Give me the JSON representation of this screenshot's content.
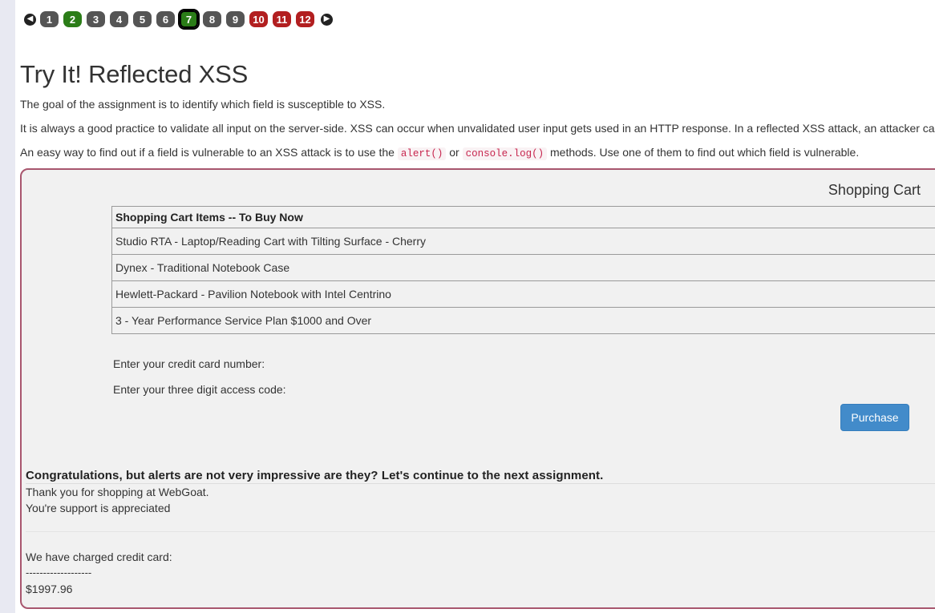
{
  "pager": {
    "prev_icon": "arrow-left-circle-icon",
    "next_icon": "arrow-right-circle-icon",
    "pages": [
      {
        "label": "1",
        "status": "grey"
      },
      {
        "label": "2",
        "status": "green"
      },
      {
        "label": "3",
        "status": "grey"
      },
      {
        "label": "4",
        "status": "grey"
      },
      {
        "label": "5",
        "status": "grey"
      },
      {
        "label": "6",
        "status": "grey"
      },
      {
        "label": "7",
        "status": "current"
      },
      {
        "label": "8",
        "status": "grey"
      },
      {
        "label": "9",
        "status": "grey"
      },
      {
        "label": "10",
        "status": "red"
      },
      {
        "label": "11",
        "status": "red"
      },
      {
        "label": "12",
        "status": "red"
      }
    ]
  },
  "colors": {
    "page_grey": "#555555",
    "page_green": "#2b7d18",
    "page_red": "#b21f20",
    "purchase_button": "#428bca",
    "panel_border": "#a8566e"
  },
  "lesson": {
    "title": "Try It! Reflected XSS",
    "para1": "The goal of the assignment is to identify which field is susceptible to XSS.",
    "para2": "It is always a good practice to validate all input on the server-side. XSS can occur when unvalidated user input gets used in an HTTP response. In a reflected XSS attack, an attacker ca",
    "para3_before": "An easy way to find out if a field is vulnerable to an XSS attack is to use the ",
    "code1": "alert()",
    "para3_or": " or ",
    "code2": "console.log()",
    "para3_after": " methods. Use one of them to find out which field is vulnerable."
  },
  "cart": {
    "title": "Shopping Cart",
    "header": "Shopping Cart Items -- To Buy Now",
    "items": [
      "Studio RTA - Laptop/Reading Cart with Tilting Surface - Cherry",
      "Dynex - Traditional Notebook Case",
      "Hewlett-Packard - Pavilion Notebook with Intel Centrino",
      "3 - Year Performance Service Plan $1000 and Over"
    ],
    "credit_card_label": "Enter your credit card number:",
    "access_code_label": "Enter your three digit access code:",
    "purchase_label": "Purchase"
  },
  "result": {
    "feedback": "Congratulations, but alerts are not very impressive are they? Let's continue to the next assignment.",
    "thanks": "Thank you for shopping at WebGoat.",
    "support": "You're support is appreciated",
    "charged": "We have charged credit card:",
    "dashes": "-------------------",
    "amount": "$1997.96"
  }
}
